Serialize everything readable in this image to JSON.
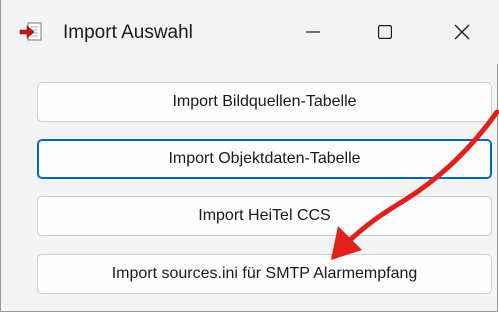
{
  "window": {
    "title": "Import Auswahl",
    "icon": "import-arrow-icon",
    "controls": {
      "minimize": "minimize-icon",
      "maximize": "maximize-icon",
      "close": "close-icon"
    }
  },
  "buttons": [
    {
      "label": "Import Bildquellen-Tabelle",
      "focused": false
    },
    {
      "label": "Import Objektdaten-Tabelle",
      "focused": true
    },
    {
      "label": "Import HeiTel CCS",
      "focused": false
    },
    {
      "label": "Import sources.ini für SMTP Alarmempfang",
      "focused": false
    }
  ],
  "colors": {
    "window_bg": "#f3f3f3",
    "focus_border": "#0067c0",
    "annotation_arrow": "#e0201b"
  }
}
